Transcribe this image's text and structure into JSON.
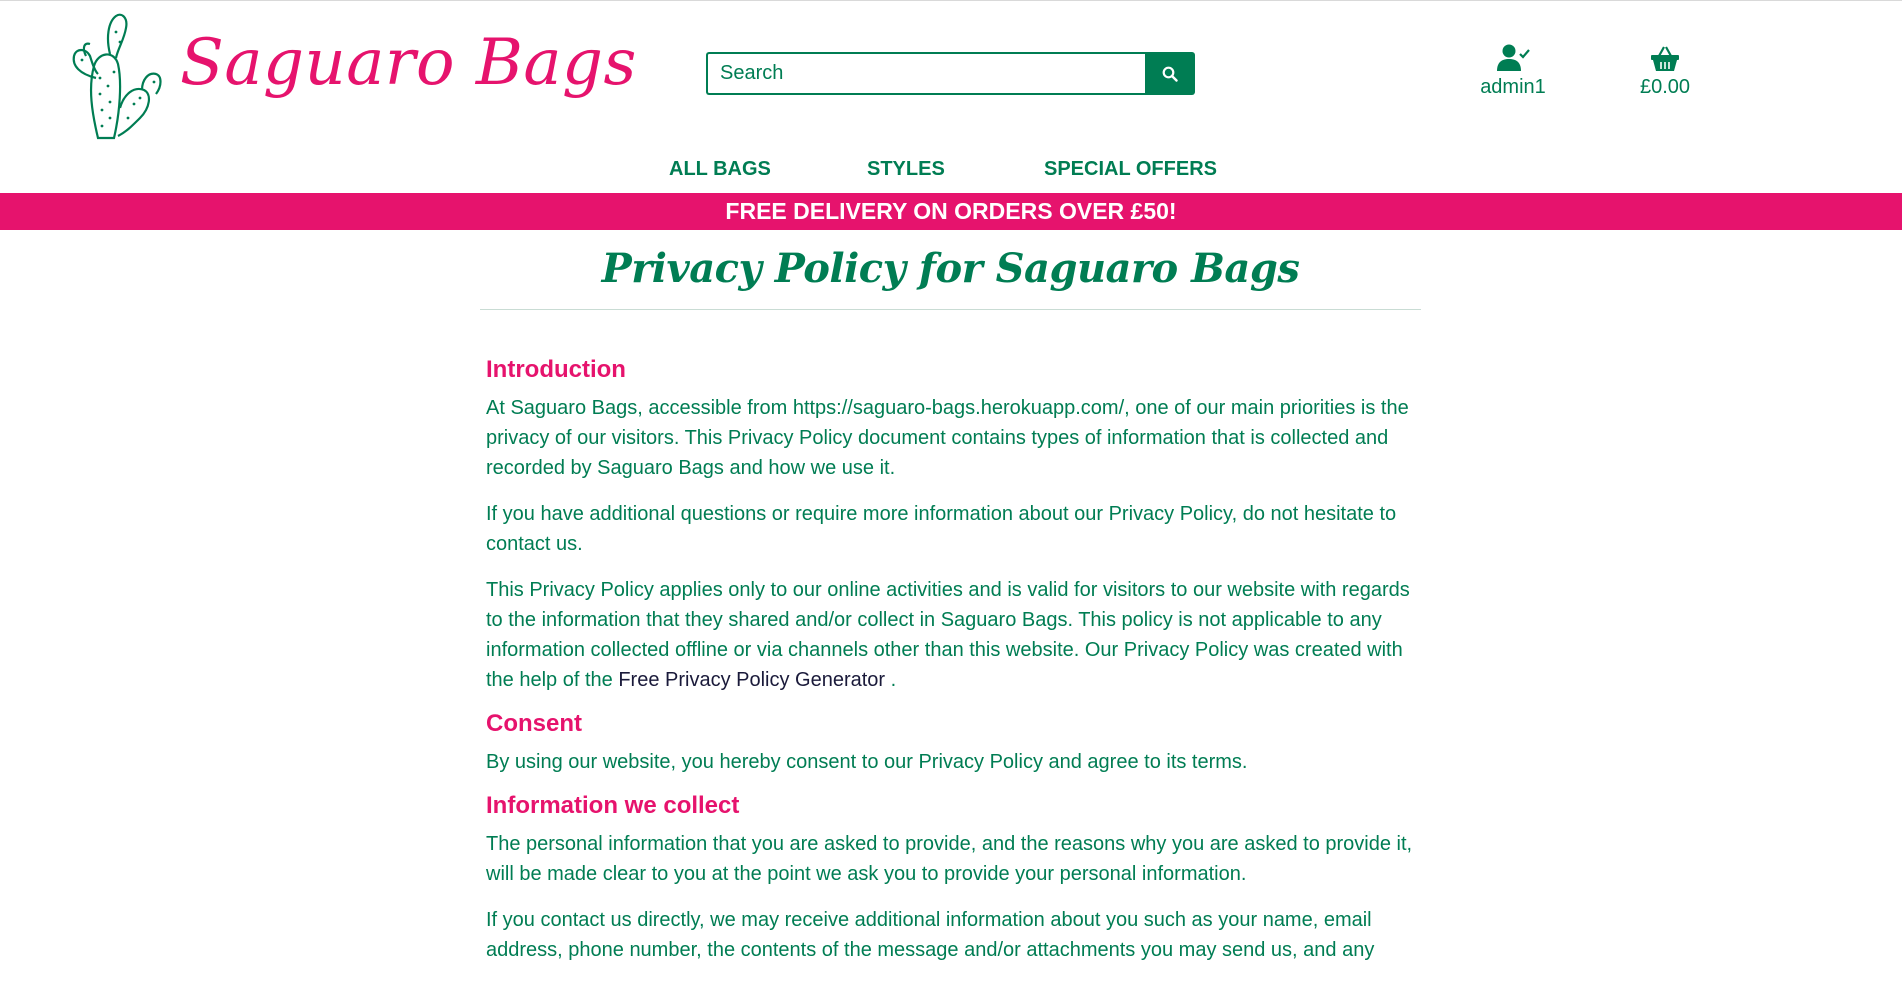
{
  "brand": {
    "name": "Saguaro Bags",
    "primary": "#007d53",
    "accent": "#e6136d"
  },
  "search": {
    "placeholder": "Search",
    "button_icon": "search-icon"
  },
  "account": {
    "label": "admin1",
    "icon": "user-check-icon"
  },
  "basket": {
    "label": "£0.00",
    "icon": "shopping-basket-icon"
  },
  "nav": {
    "items": [
      {
        "label": "ALL BAGS"
      },
      {
        "label": "STYLES"
      },
      {
        "label": "SPECIAL OFFERS"
      }
    ]
  },
  "banner": {
    "text": "FREE DELIVERY ON ORDERS OVER £50!"
  },
  "page": {
    "title": "Privacy Policy for Saguaro Bags",
    "sections": {
      "intro": {
        "heading": "Introduction",
        "p1": "At Saguaro Bags, accessible from https://saguaro-bags.herokuapp.com/, one of our main priorities is the privacy of our visitors. This Privacy Policy document contains types of information that is collected and recorded by Saguaro Bags and how we use it.",
        "p2": "If you have additional questions or require more information about our Privacy Policy, do not hesitate to contact us.",
        "p3_before": "This Privacy Policy applies only to our online activities and is valid for visitors to our website with regards to the information that they shared and/or collect in Saguaro Bags. This policy is not applicable to any information collected offline or via channels other than this website. Our Privacy Policy was created with the help of the ",
        "p3_link": "Free Privacy Policy Generator",
        "p3_after": " ."
      },
      "consent": {
        "heading": "Consent",
        "p1": "By using our website, you hereby consent to our Privacy Policy and agree to its terms."
      },
      "collect": {
        "heading": "Information we collect",
        "p1": "The personal information that you are asked to provide, and the reasons why you are asked to provide it, will be made clear to you at the point we ask you to provide your personal information.",
        "p2": "If you contact us directly, we may receive additional information about you such as your name, email address, phone number, the contents of the message and/or attachments you may send us, and any"
      }
    }
  }
}
